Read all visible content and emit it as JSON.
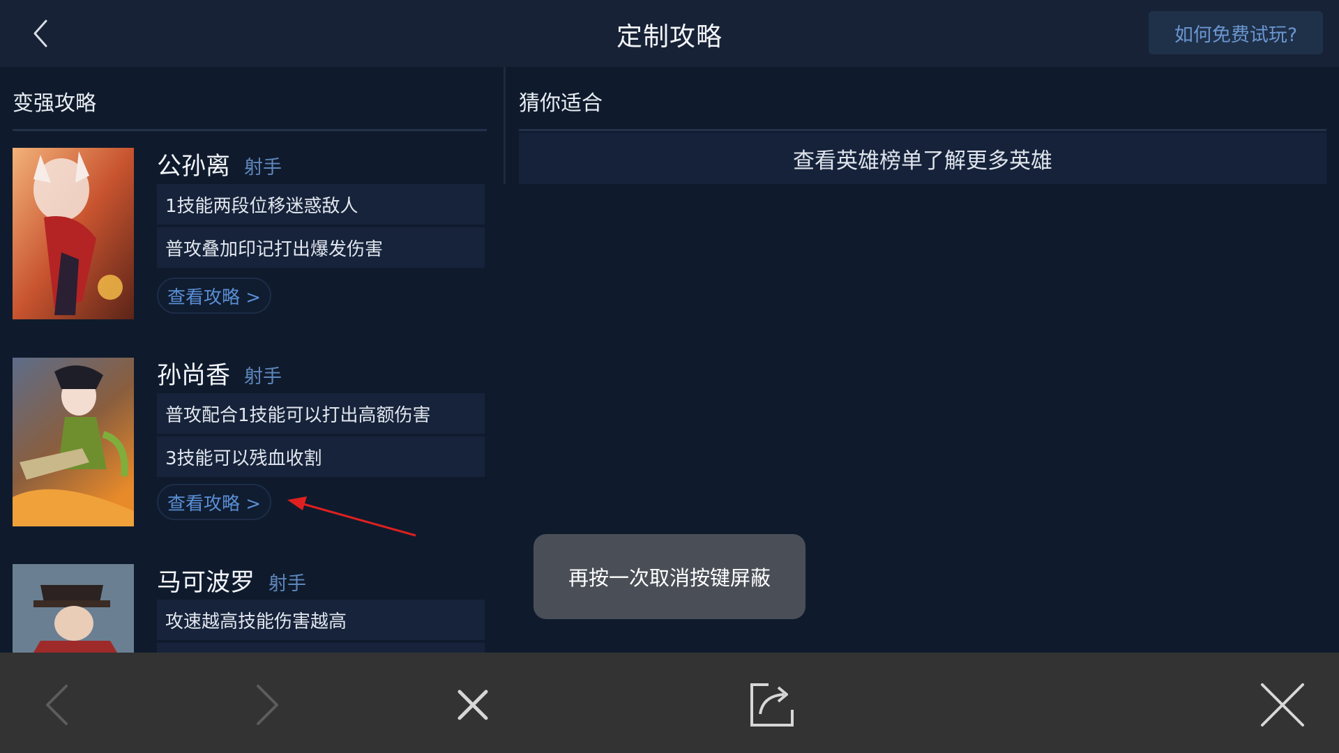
{
  "header": {
    "title": "定制攻略",
    "free_trial_label": "如何免费试玩?"
  },
  "left": {
    "section_title": "变强攻略",
    "heroes": [
      {
        "name": "公孙离",
        "role": "射手",
        "tips": [
          "1技能两段位移迷惑敌人",
          "普攻叠加印记打出爆发伤害"
        ],
        "guide_label": "查看攻略 >"
      },
      {
        "name": "孙尚香",
        "role": "射手",
        "tips": [
          "普攻配合1技能可以打出高额伤害",
          "3技能可以残血收割"
        ],
        "guide_label": "查看攻略 >"
      },
      {
        "name": "马可波罗",
        "role": "射手",
        "tips": [
          "攻速越高技能伤害越高"
        ]
      }
    ]
  },
  "right": {
    "section_title": "猜你适合",
    "rank_link": "查看英雄榜单了解更多英雄"
  },
  "toast": "再按一次取消按键屏蔽",
  "colors": {
    "background": "#0f1b2d",
    "header": "#172236",
    "accent": "#5a8ed3",
    "annotation_arrow": "#e02020",
    "bottom_bar": "#333333"
  },
  "icons": {
    "back": "chevron-left-icon",
    "nav_prev": "chevron-left-icon",
    "nav_next": "chevron-right-icon",
    "close_small": "close-icon",
    "share": "share-icon",
    "close_large": "close-icon"
  }
}
